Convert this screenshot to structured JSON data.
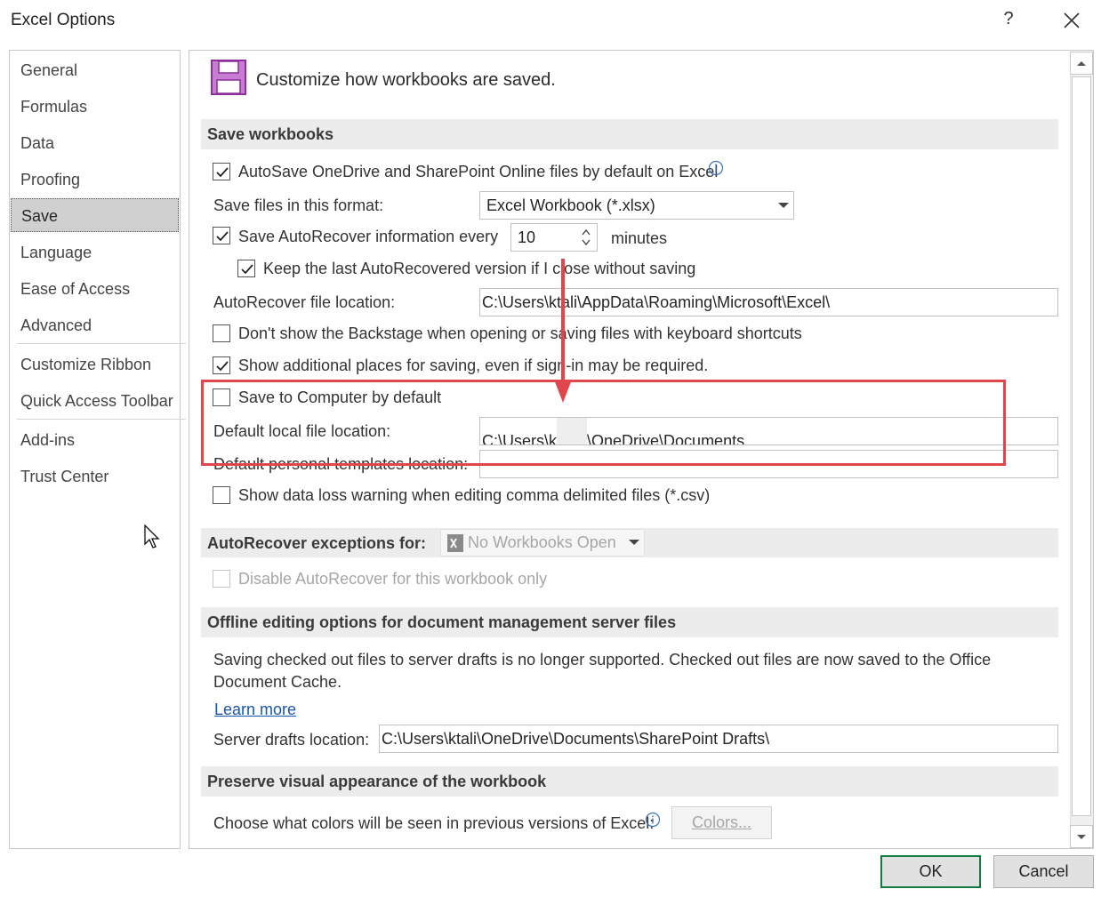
{
  "window": {
    "title": "Excel Options",
    "help_label": "?",
    "colors": {
      "accent_green": "#107c41",
      "annotation_red": "#e0474c",
      "save_icon_purple": "#a63fb3"
    }
  },
  "sidebar": {
    "items": [
      {
        "label": "General"
      },
      {
        "label": "Formulas"
      },
      {
        "label": "Data"
      },
      {
        "label": "Proofing"
      },
      {
        "label": "Save",
        "selected": true
      },
      {
        "label": "Language"
      },
      {
        "label": "Ease of Access"
      },
      {
        "label": "Advanced"
      },
      {
        "label": "Customize Ribbon"
      },
      {
        "label": "Quick Access Toolbar"
      },
      {
        "label": "Add-ins"
      },
      {
        "label": "Trust Center"
      }
    ]
  },
  "header": {
    "title": "Customize how workbooks are saved.",
    "icon": "floppy-disk-icon"
  },
  "save_workbooks": {
    "heading": "Save workbooks",
    "autosave": {
      "label": "AutoSave OneDrive and SharePoint Online files by default on Excel",
      "checked": true
    },
    "format": {
      "label": "Save files in this format:",
      "value": "Excel Workbook (*.xlsx)"
    },
    "autorecover": {
      "label": "Save AutoRecover information every",
      "value": "10",
      "unit": "minutes",
      "checked": true
    },
    "keep_last": {
      "label": "Keep the last AutoRecovered version if I close without saving",
      "checked": true
    },
    "autorecover_location": {
      "label": "AutoRecover file location:",
      "value": "C:\\Users\\ktali\\AppData\\Roaming\\Microsoft\\Excel\\"
    },
    "backstage": {
      "label": "Don't show the Backstage when opening or saving files with keyboard shortcuts",
      "checked": false
    },
    "additional_places": {
      "label": "Show additional places for saving, even if sign-in may be required.",
      "checked": true
    },
    "save_to_computer": {
      "label": "Save to Computer by default",
      "checked": false
    },
    "default_local": {
      "label": "Default local file location:",
      "value_prefix": "C:\\Users\\k",
      "value_suffix": "\\OneDrive\\Documents"
    },
    "templates": {
      "label": "Default personal templates location:",
      "value": ""
    },
    "data_loss": {
      "label": "Show data loss warning when editing comma delimited files (*.csv)",
      "checked": false
    }
  },
  "exceptions": {
    "heading": "AutoRecover exceptions for:",
    "workbook": "No Workbooks Open",
    "disable": {
      "label": "Disable AutoRecover for this workbook only",
      "checked": false
    }
  },
  "offline": {
    "heading": "Offline editing options for document management server files",
    "description_line1": "Saving checked out files to server drafts is no longer supported. Checked out files are now saved to the Office",
    "description_line2": "Document Cache.",
    "learn_more": "Learn more",
    "drafts": {
      "label": "Server drafts location:",
      "value": "C:\\Users\\ktali\\OneDrive\\Documents\\SharePoint Drafts\\"
    }
  },
  "appearance": {
    "heading": "Preserve visual appearance of the workbook",
    "colors_label": "Choose what colors will be seen in previous versions of Excel:",
    "colors_button": "Colors..."
  },
  "footer": {
    "ok": "OK",
    "cancel": "Cancel"
  }
}
